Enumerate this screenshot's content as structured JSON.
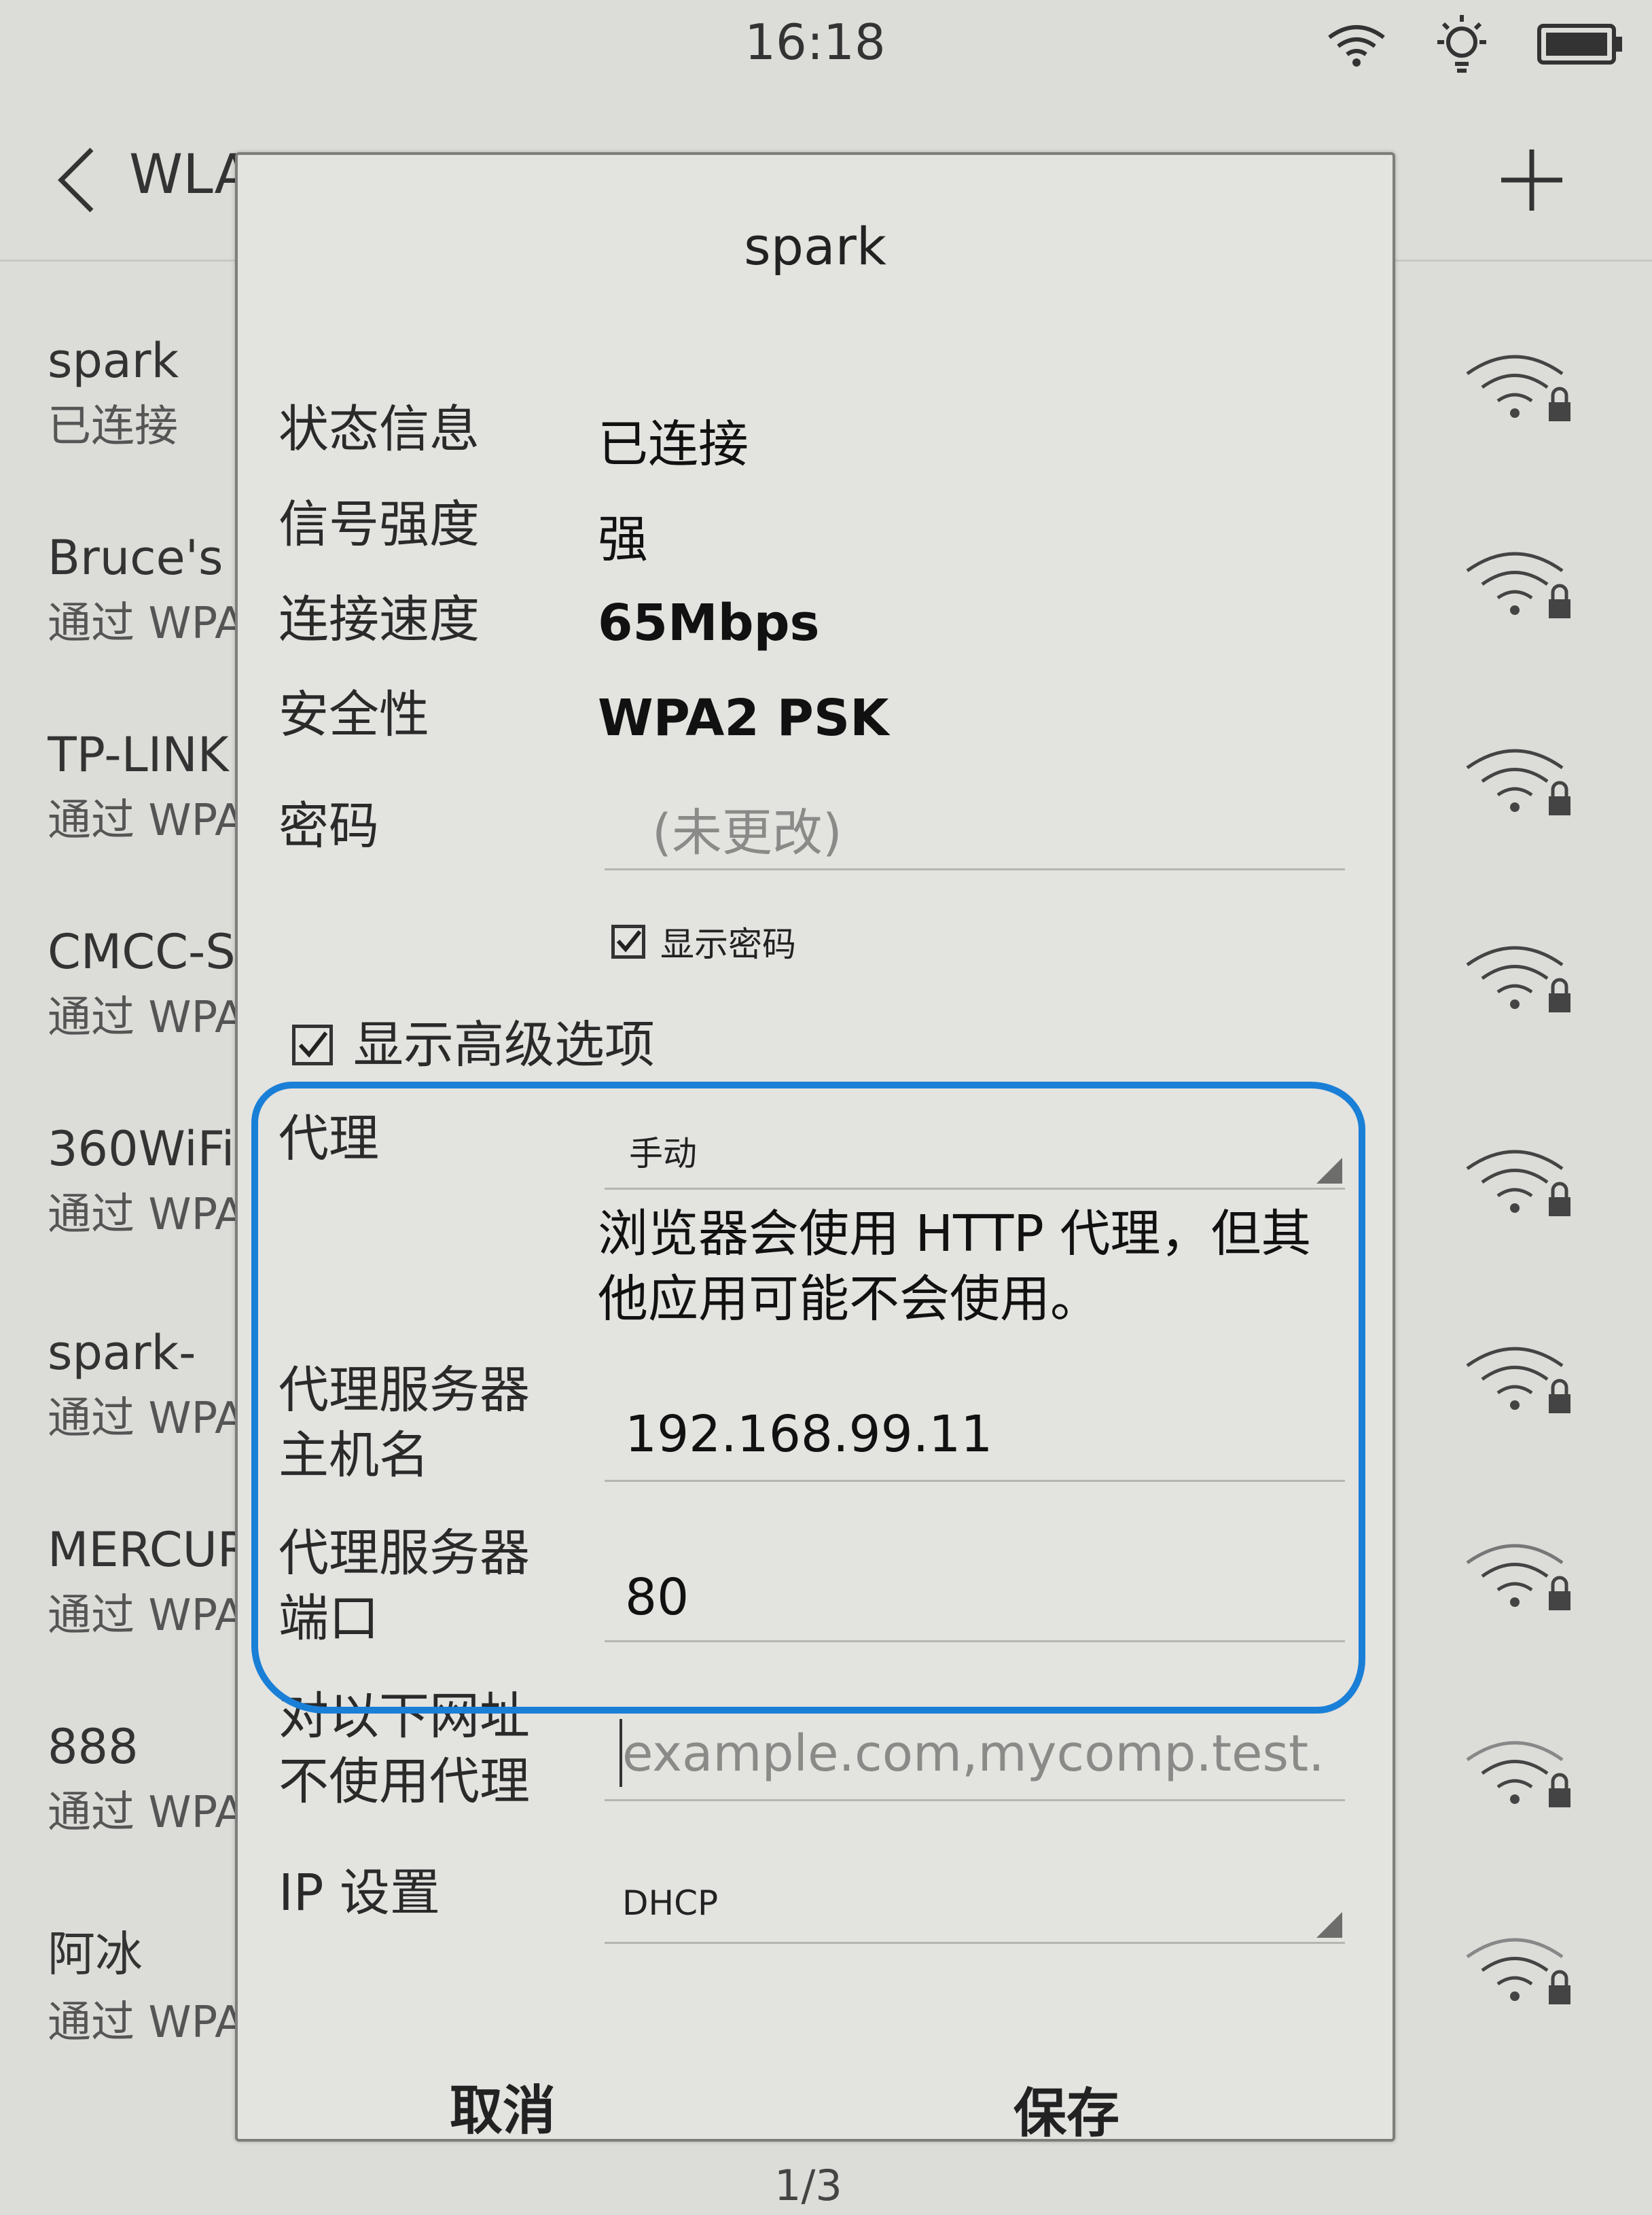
{
  "status_bar": {
    "time": "16:18",
    "icons": [
      "wifi-icon",
      "brightness-icon",
      "battery-icon"
    ]
  },
  "header": {
    "title": "WLAN",
    "back_icon": "back-chevron-icon",
    "add_icon": "plus-icon"
  },
  "networks": [
    {
      "name": "spark",
      "status": "已连接"
    },
    {
      "name": "Bruce's i",
      "status": "通过 WPA"
    },
    {
      "name": "TP-LINK",
      "status": "通过 WPA"
    },
    {
      "name": "CMCC-S",
      "status": "通过 WPA"
    },
    {
      "name": "360WiFi",
      "status": "通过 WPA"
    },
    {
      "name": "spark-",
      "status": "通过 WPA"
    },
    {
      "name": "MERCUR",
      "status": "通过 WPA"
    },
    {
      "name": "888",
      "status": "通过 WPA"
    },
    {
      "name": "阿冰",
      "status": "通过 WPA"
    }
  ],
  "dialog": {
    "title": "spark",
    "status_label": "状态信息",
    "status_value": "已连接",
    "signal_label": "信号强度",
    "signal_value": "强",
    "speed_label": "连接速度",
    "speed_value": "65Mbps",
    "security_label": "安全性",
    "security_value": "WPA2 PSK",
    "password_label": "密码",
    "password_placeholder": "(未更改)",
    "show_password_label": "显示密码",
    "show_password_checked": true,
    "advanced_label": "显示高级选项",
    "advanced_checked": true,
    "proxy_label": "代理",
    "proxy_value": "手动",
    "proxy_note": "浏览器会使用 HTTP 代理，但其他应用可能不会使用。",
    "proxy_host_label_1": "代理服务器",
    "proxy_host_label_2": "主机名",
    "proxy_host_value": "192.168.99.11",
    "proxy_port_label_1": "代理服务器",
    "proxy_port_label_2": "端口",
    "proxy_port_value": "80",
    "bypass_label_1": "对以下网址",
    "bypass_label_2": "不使用代理",
    "bypass_placeholder": "example.com,mycomp.test.",
    "ip_label": "IP 设置",
    "ip_value": "DHCP",
    "cancel_label": "取消",
    "save_label": "保存"
  },
  "page_indicator": "1/3",
  "colors": {
    "highlight": "#1a7fd6",
    "screen_bg": "#dcdcd8",
    "dialog_bg": "#e3e3e0"
  }
}
